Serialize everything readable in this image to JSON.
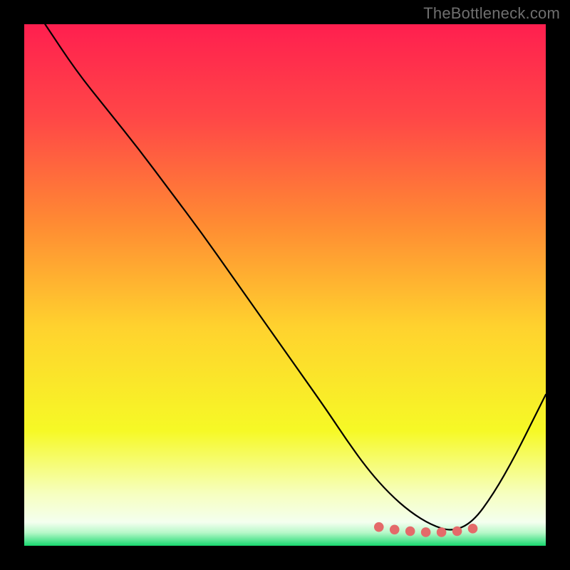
{
  "watermark": "TheBottleneck.com",
  "chart_data": {
    "type": "line",
    "title": "",
    "xlabel": "",
    "ylabel": "",
    "xlim": [
      0,
      100
    ],
    "ylim": [
      0,
      100
    ],
    "grid": false,
    "background_gradient": {
      "type": "vertical",
      "stops": [
        {
          "offset": 0.0,
          "color": "#ff1f4f"
        },
        {
          "offset": 0.18,
          "color": "#ff4747"
        },
        {
          "offset": 0.38,
          "color": "#ff8a33"
        },
        {
          "offset": 0.58,
          "color": "#ffd22e"
        },
        {
          "offset": 0.78,
          "color": "#f6f926"
        },
        {
          "offset": 0.9,
          "color": "#f6ffbf"
        },
        {
          "offset": 0.955,
          "color": "#f4ffef"
        },
        {
          "offset": 0.975,
          "color": "#b6f8c8"
        },
        {
          "offset": 1.0,
          "color": "#18d96f"
        }
      ]
    },
    "series": [
      {
        "name": "bottleneck-curve",
        "color": "#000000",
        "stroke_width": 2.2,
        "x": [
          4,
          10,
          16,
          22,
          28,
          34,
          40,
          46,
          52,
          58,
          62,
          66,
          70,
          74,
          78,
          82,
          86,
          90,
          94,
          98,
          100
        ],
        "values": [
          100,
          91,
          83.5,
          76,
          68,
          60,
          51.5,
          43,
          34.5,
          26,
          20,
          14.5,
          10,
          6.5,
          4,
          2.7,
          4.5,
          10,
          17,
          25,
          29
        ]
      }
    ],
    "markers": {
      "name": "optimal-zone-dots",
      "color": "#e46a6a",
      "radius": 6.8,
      "x": [
        68,
        71,
        74,
        77,
        80,
        83,
        86
      ],
      "values": [
        3.6,
        3.1,
        2.8,
        2.6,
        2.6,
        2.8,
        3.3
      ]
    }
  }
}
